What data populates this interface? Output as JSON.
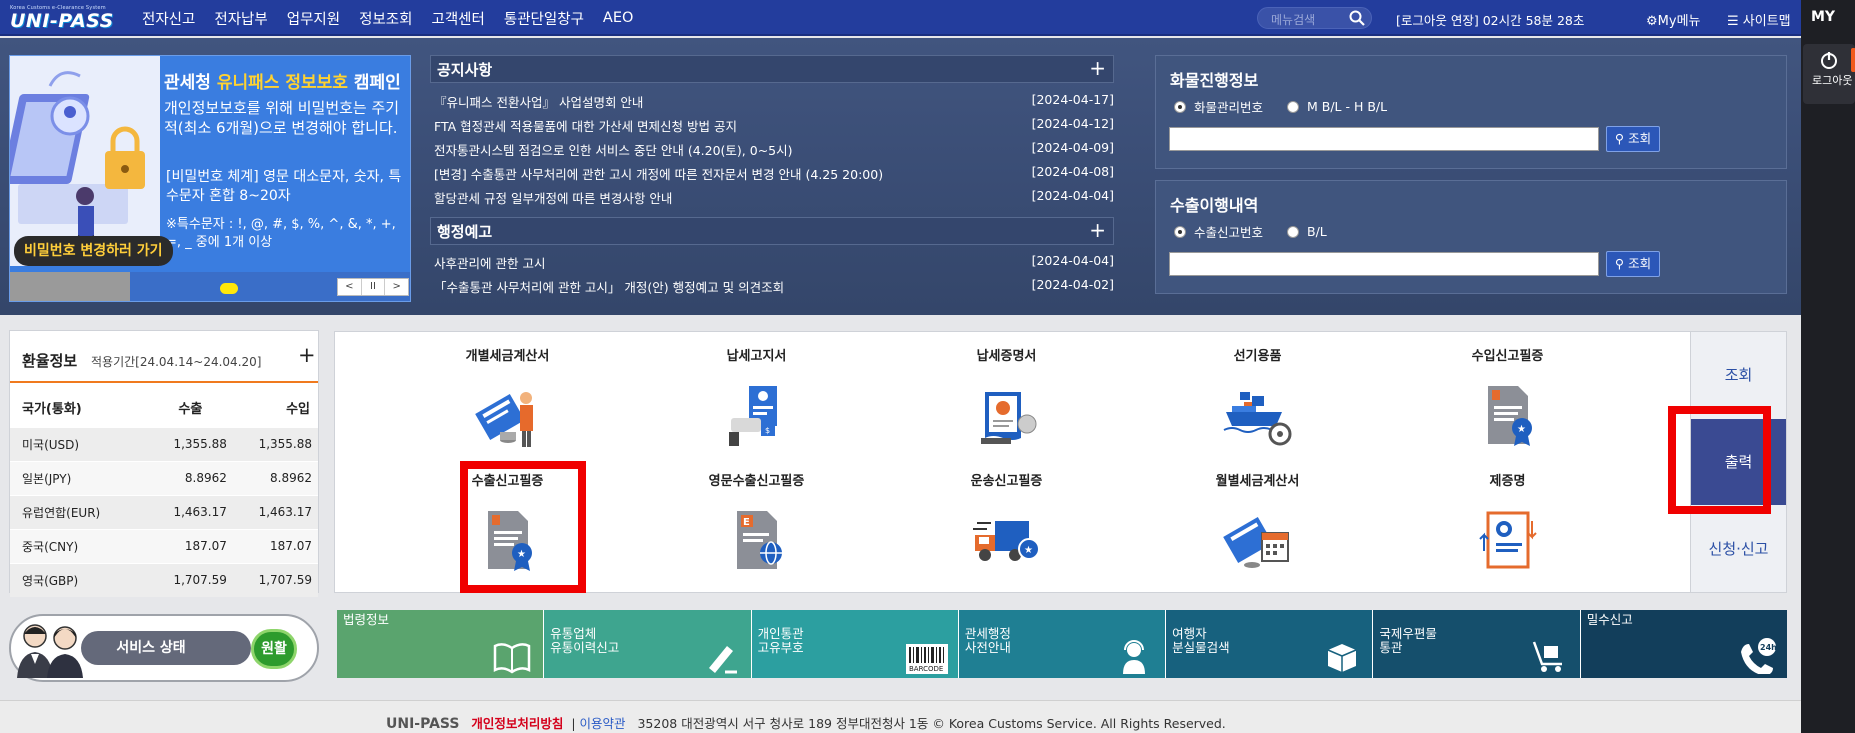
{
  "header": {
    "logo_sub": "Korea Customs e-Clearance System",
    "logo_main": "UNI-PASS",
    "menu": [
      "전자신고",
      "전자납부",
      "업무지원",
      "정보조회",
      "고객센터",
      "통관단일창구",
      "AEO"
    ],
    "search_placeholder": "메뉴검색",
    "session": "[로그아웃 연장] 02시간 58분 28초",
    "my_menu": "My메뉴",
    "sitemap": "사이트맵"
  },
  "right_panel": {
    "my": "MY",
    "logout": "로그아웃"
  },
  "banner": {
    "title_a": "관세청",
    "title_b": "유니패스 정보보호",
    "title_c": "캠페인",
    "line1": "개인정보보호를 위해 비밀번호는 주기적(최소 6개월)으로 변경해야 합니다.",
    "line2": "[비밀번호 체계] 영문 대소문자, 숫자, 특수문자 혼합 8~20자",
    "line3": "※특수문자 : !, @, #, $, %, ^, &, *, +, =, _ 중에 1개 이상",
    "button": "비밀번호 변경하러 가기",
    "controls": [
      "<",
      "II",
      ">"
    ]
  },
  "notices": {
    "title": "공지사항",
    "items": [
      {
        "text": "『유니패스 전환사업』 사업설명회 안내",
        "date": "[2024-04-17]"
      },
      {
        "text": "FTA 협정관세 적용물품에 대한 가산세 면제신청 방법 공지",
        "date": "[2024-04-12]"
      },
      {
        "text": "전자통관시스템 점검으로 인한 서비스 중단 안내 (4.20(토), 0~5시)",
        "date": "[2024-04-09]"
      },
      {
        "text": "[변경] 수출통관 사무처리에 관한 고시 개정에 따른 전자문서 변경 안내 (4.25 20:00)",
        "date": "[2024-04-08]"
      },
      {
        "text": "할당관세 규정 일부개정에 따른 변경사항 안내",
        "date": "[2024-04-04]"
      }
    ]
  },
  "admin_notices": {
    "title": "행정예고",
    "items": [
      {
        "text": "사후관리에 관한 고시",
        "date": "[2024-04-04]"
      },
      {
        "text": "「수출통관 사무처리에 관한 고시」 개정(안) 행정예고 및 의견조회",
        "date": "[2024-04-02]"
      }
    ]
  },
  "cargo": {
    "title": "화물진행정보",
    "radio1": "화물관리번호",
    "radio2": "M B/L - H B/L",
    "button": "조회"
  },
  "export": {
    "title": "수출이행내역",
    "radio1": "수출신고번호",
    "radio2": "B/L",
    "button": "조회"
  },
  "rates": {
    "title": "환율정보",
    "period": "적용기간[24.04.14~24.04.20]",
    "headers": [
      "국가(통화)",
      "수출",
      "수입"
    ],
    "rows": [
      [
        "미국(USD)",
        "1,355.88",
        "1,355.88"
      ],
      [
        "일본(JPY)",
        "8.8962",
        "8.8962"
      ],
      [
        "유럽연합(EUR)",
        "1,463.17",
        "1,463.17"
      ],
      [
        "중국(CNY)",
        "187.07",
        "187.07"
      ],
      [
        "영국(GBP)",
        "1,707.59",
        "1,707.59"
      ]
    ]
  },
  "status": {
    "label": "서비스 상태",
    "value": "원활"
  },
  "services": {
    "row1": [
      "개별세금계산서",
      "납세고지서",
      "납세증명서",
      "선기용품",
      "수입신고필증"
    ],
    "row2": [
      "수출신고필증",
      "영문수출신고필증",
      "운송신고필증",
      "월별세금계산서",
      "제증명"
    ]
  },
  "side_tabs": [
    "조회",
    "출력",
    "신청·신고"
  ],
  "quick_links": [
    {
      "label": "법령정보",
      "color": "#5aa46e",
      "icon": "book-icon"
    },
    {
      "label": "유통업체\n유통이력신고",
      "color": "#3ea58f",
      "icon": "pen-icon"
    },
    {
      "label": "개인통관\n고유부호",
      "color": "#2c9fa0",
      "icon": "barcode-icon"
    },
    {
      "label": "관세행정\n사전안내",
      "color": "#1f7f93",
      "icon": "headset-icon"
    },
    {
      "label": "여행자\n분실물검색",
      "color": "#17617e",
      "icon": "box-icon"
    },
    {
      "label": "국제우편물\n통관",
      "color": "#154f6c",
      "icon": "cart-icon"
    },
    {
      "label": "밀수신고",
      "color": "#123e5b",
      "icon": "phone-24h-icon"
    }
  ],
  "quick_extra": {
    "barcode": "BARCODE",
    "h24": "24h"
  },
  "footer": {
    "brand": "UNI-PASS",
    "privacy": "개인정보처리방침",
    "terms": "이용약관",
    "address": "35208 대전광역시 서구 청사로 189 정부대전청사 1동 © Korea Customs Service. All Rights Reserved."
  }
}
